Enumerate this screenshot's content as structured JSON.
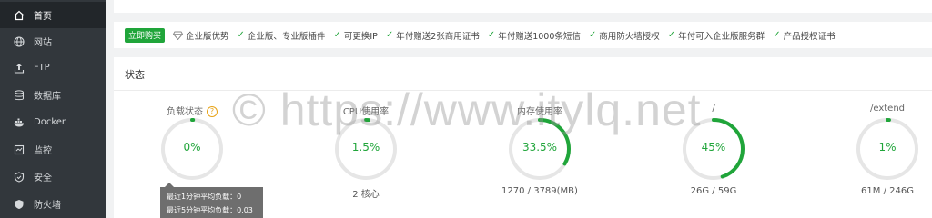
{
  "sidebar": {
    "items": [
      {
        "label": "首页",
        "icon": "home-icon",
        "active": true
      },
      {
        "label": "网站",
        "icon": "globe-icon"
      },
      {
        "label": "FTP",
        "icon": "ftp-icon"
      },
      {
        "label": "数据库",
        "icon": "database-icon"
      },
      {
        "label": "Docker",
        "icon": "docker-icon"
      },
      {
        "label": "监控",
        "icon": "monitor-icon"
      },
      {
        "label": "安全",
        "icon": "shield-icon"
      },
      {
        "label": "防火墙",
        "icon": "firewall-shield-icon"
      }
    ]
  },
  "features": {
    "buy_label": "立即购买",
    "enterprise_label": "企业版优势",
    "items": [
      "企业版、专业版插件",
      "可更换IP",
      "年付赠送2张商用证书",
      "年付赠送1000条短信",
      "商用防火墙授权",
      "年付可入企业版服务群",
      "产品授权证书"
    ]
  },
  "status": {
    "title": "状态",
    "gauges": [
      {
        "title": "负载状态",
        "value_text": "0%",
        "percent": 0,
        "sub": "",
        "help": "?"
      },
      {
        "title": "CPU使用率",
        "value_text": "1.5%",
        "percent": 1.5,
        "sub": "2 核心"
      },
      {
        "title": "内存使用率",
        "value_text": "33.5%",
        "percent": 33.5,
        "sub": "1270 / 3789(MB)"
      },
      {
        "title": "/",
        "value_text": "45%",
        "percent": 45,
        "sub": "26G / 59G"
      },
      {
        "title": "/extend",
        "value_text": "1%",
        "percent": 1,
        "sub": "61M / 246G"
      }
    ],
    "tooltip": {
      "line1": "最近1分钟平均负载：0",
      "line2": "最近5分钟平均负载：0.03"
    }
  },
  "watermark": "© https://www.itylq.net",
  "colors": {
    "accent": "#20a53a",
    "sidebar_bg": "#32373c",
    "ring_bg": "#e6e6e6",
    "help": "#e8a317"
  }
}
